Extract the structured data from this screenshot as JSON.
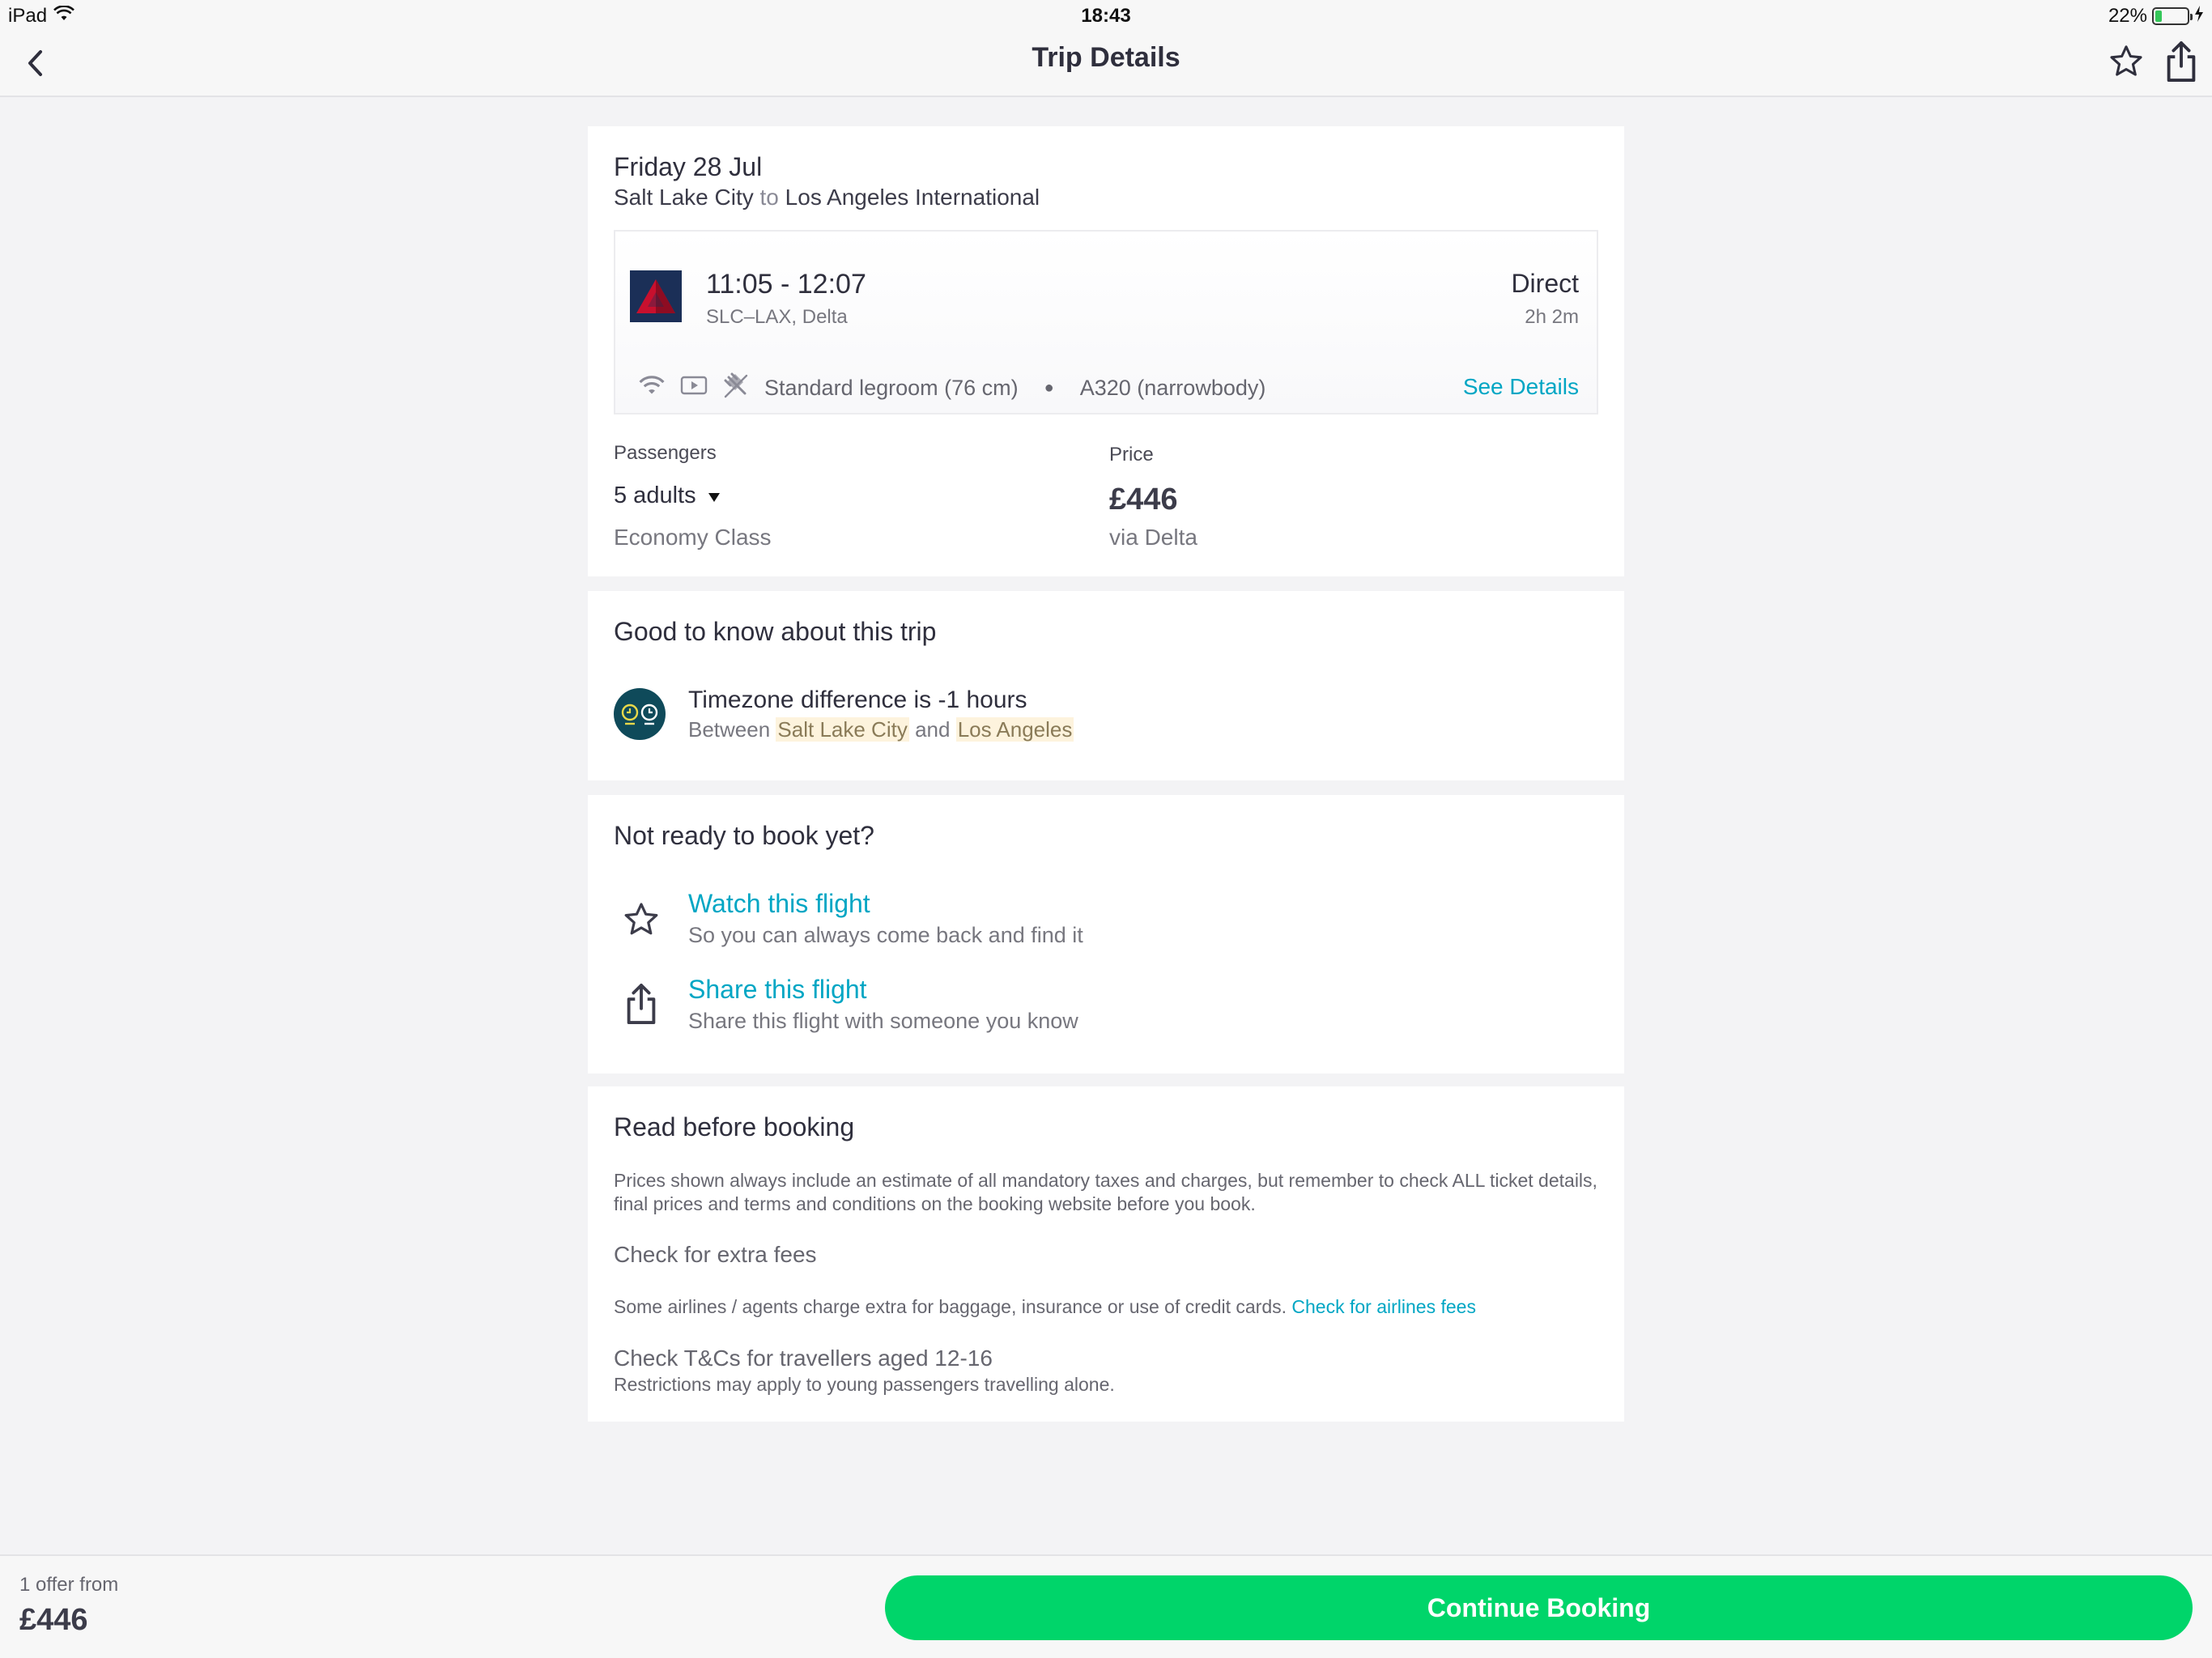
{
  "status": {
    "device": "iPad",
    "time": "18:43",
    "battery": "22%",
    "battery_level": 0.22
  },
  "nav": {
    "title": "Trip Details"
  },
  "trip": {
    "date": "Friday 28 Jul",
    "origin": "Salt Lake City",
    "connector": "to",
    "destination": "Los Angeles International"
  },
  "flight": {
    "times": "11:05 - 12:07",
    "route_airline": "SLC–LAX, Delta",
    "stops": "Direct",
    "duration": "2h 2m",
    "legroom": "Standard legroom (76 cm)",
    "aircraft": "A320 (narrowbody)",
    "see_details": "See Details",
    "amenity_icons": [
      "wifi-icon",
      "video-icon",
      "no-power-icon"
    ]
  },
  "booking": {
    "passengers_label": "Passengers",
    "passengers_value": "5 adults",
    "cabin_class": "Economy Class",
    "price_label": "Price",
    "price_value": "£446",
    "via": "via Delta"
  },
  "good_to_know": {
    "title": "Good to know about this trip",
    "tz_main": "Timezone difference is -1 hours",
    "tz_between": "Between",
    "tz_city1": "Salt Lake City",
    "tz_and": "and",
    "tz_city2": "Los Angeles"
  },
  "not_ready": {
    "title": "Not ready to book yet?",
    "watch_title": "Watch this flight",
    "watch_sub": "So you can always come back and find it",
    "share_title": "Share this flight",
    "share_sub": "Share this flight with someone you know"
  },
  "read_before": {
    "title": "Read before booking",
    "prices_text": "Prices shown always include an estimate of all mandatory taxes and charges, but remember to check ALL ticket details, final prices and terms and conditions on the booking website before you book.",
    "extra_fees_title": "Check for extra fees",
    "extra_fees_text": "Some airlines / agents charge extra for baggage, insurance or use of credit cards.",
    "extra_fees_link": "Check for airlines fees",
    "tcs_title": "Check T&Cs for travellers aged 12-16",
    "tcs_text": "Restrictions may apply to young passengers travelling alone."
  },
  "footer": {
    "offer_label": "1 offer from",
    "offer_price": "£446",
    "continue_label": "Continue Booking"
  },
  "colors": {
    "accent": "#00a6c4",
    "cta": "#00d56a",
    "delta_navy": "#1b2f57",
    "delta_red": "#c8102e"
  }
}
